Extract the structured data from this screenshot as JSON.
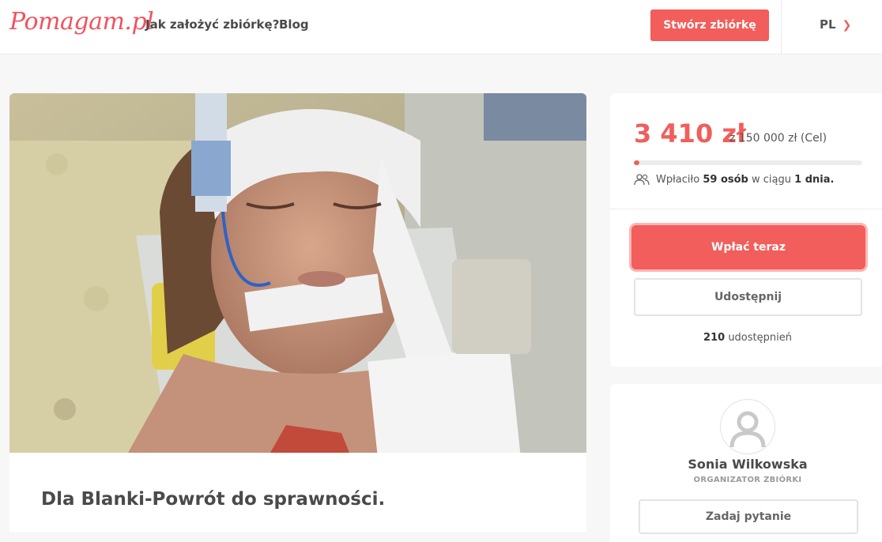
{
  "header": {
    "logo_text": "Pomagam.pl",
    "nav": {
      "how_to": "Jak założyć zbiórkę?",
      "blog": "Blog"
    },
    "create_button": "Stwórz zbiórkę",
    "language": "PL",
    "language_icon": "chevron-down-icon"
  },
  "fundraiser": {
    "photo_alt": "photo-of-child-in-hospital",
    "title": "Dla Blanki-Powrót do sprawności."
  },
  "donation": {
    "raised": "3 410 zł",
    "goal_text": "z 150 000 zł (Cel)",
    "progress_fraction": 0.0227,
    "donors_prefix": "Wpłaciło",
    "donors_count": "59 osób",
    "donors_mid": "w ciągu",
    "donors_period": "1 dnia.",
    "pay_button": "Wpłać teraz",
    "share_button": "Udostępnij",
    "shares_count": "210",
    "shares_label": "udostępnień"
  },
  "organizer": {
    "name": "Sonia Wilkowska",
    "role": "ORGANIZATOR ZBIÓRKI",
    "ask_button": "Zadaj pytanie"
  },
  "colors": {
    "accent": "#f15e5b",
    "background": "#f7f7f7"
  }
}
